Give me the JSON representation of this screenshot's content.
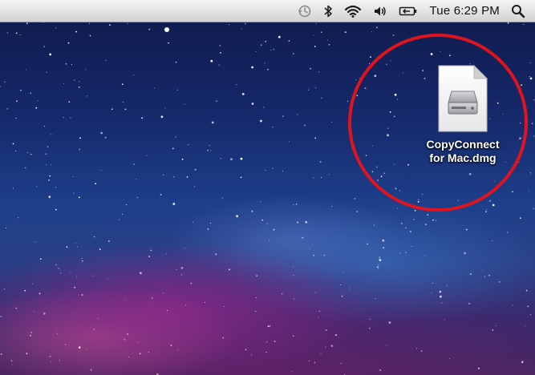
{
  "menubar": {
    "status_icons": [
      {
        "name": "time-machine-icon"
      },
      {
        "name": "bluetooth-icon"
      },
      {
        "name": "wifi-icon"
      },
      {
        "name": "volume-icon"
      },
      {
        "name": "battery-icon"
      }
    ],
    "clock": "Tue 6:29 PM",
    "spotlight_icon": "magnifying-glass"
  },
  "desktop": {
    "wallpaper": "galaxy",
    "file": {
      "name_line1": "CopyConnect",
      "name_line2": "for Mac.dmg",
      "icon": "disk-image-document"
    },
    "annotation": {
      "shape": "circle",
      "color": "#e0141e"
    }
  }
}
